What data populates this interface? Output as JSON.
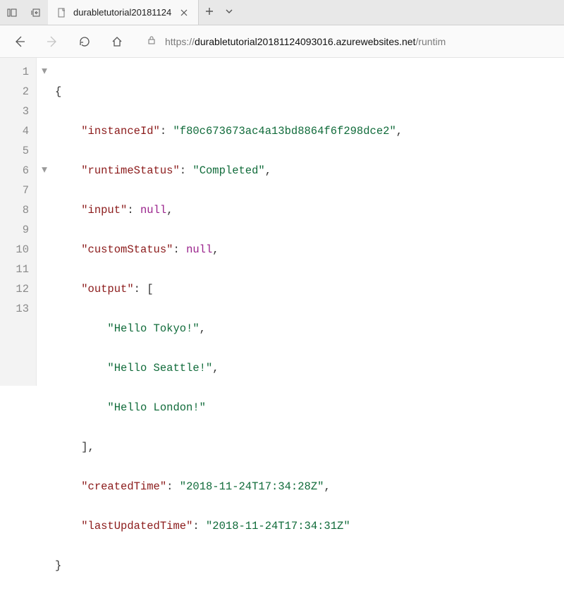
{
  "tab": {
    "title": "durabletutorial20181124"
  },
  "url": {
    "scheme": "https://",
    "host": "durabletutorial20181124093016.azurewebsites.net",
    "path": "/runtim"
  },
  "lines": [
    "1",
    "2",
    "3",
    "4",
    "5",
    "6",
    "7",
    "8",
    "9",
    "10",
    "11",
    "12",
    "13"
  ],
  "json": {
    "instanceId_key": "instanceId",
    "instanceId_val": "f80c673673ac4a13bd8864f6f298dce2",
    "runtimeStatus_key": "runtimeStatus",
    "runtimeStatus_val": "Completed",
    "input_key": "input",
    "input_val": "null",
    "customStatus_key": "customStatus",
    "customStatus_val": "null",
    "output_key": "output",
    "output_0": "Hello Tokyo!",
    "output_1": "Hello Seattle!",
    "output_2": "Hello London!",
    "createdTime_key": "createdTime",
    "createdTime_val": "2018-11-24T17:34:28Z",
    "lastUpdatedTime_key": "lastUpdatedTime",
    "lastUpdatedTime_val": "2018-11-24T17:34:31Z"
  }
}
